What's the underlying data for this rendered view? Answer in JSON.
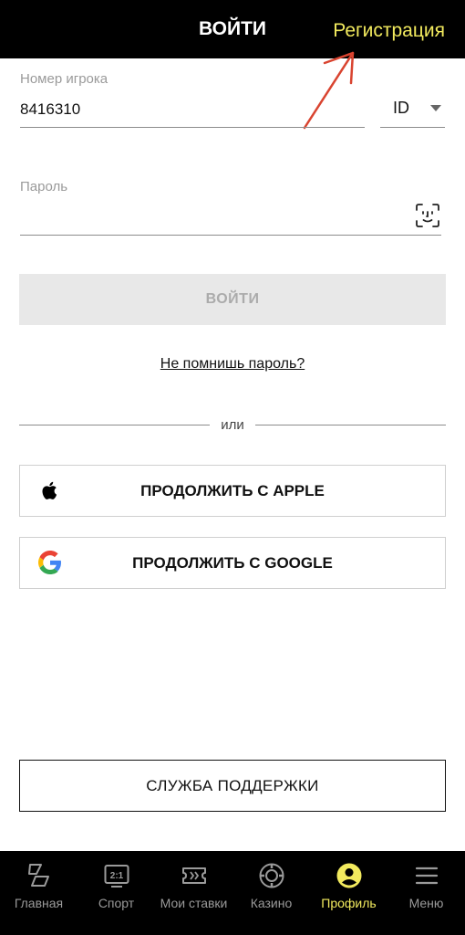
{
  "header": {
    "title": "ВОЙТИ",
    "register_link": "Регистрация"
  },
  "form": {
    "player_number_label": "Номер игрока",
    "player_number_value": "8416310",
    "id_type": "ID",
    "password_label": "Пароль",
    "login_button": "ВОЙТИ",
    "forgot_password": "Не помнишь пароль?",
    "or_text": "или"
  },
  "social": {
    "apple_label": "ПРОДОЛЖИТЬ С APPLE",
    "google_label": "ПРОДОЛЖИТЬ С GOOGLE"
  },
  "support_button": "СЛУЖБА ПОДДЕРЖКИ",
  "tabbar": {
    "items": [
      {
        "label": "Главная",
        "icon": "home-icon"
      },
      {
        "label": "Спорт",
        "icon": "sport-score-icon"
      },
      {
        "label": "Мои ставки",
        "icon": "ticket-icon"
      },
      {
        "label": "Казино",
        "icon": "casino-chip-icon"
      },
      {
        "label": "Профиль",
        "icon": "profile-icon",
        "active": true
      },
      {
        "label": "Меню",
        "icon": "menu-icon"
      }
    ]
  },
  "colors": {
    "accent": "#f2ea5e",
    "header_bg": "#000000",
    "annotation_arrow": "#d94430"
  }
}
